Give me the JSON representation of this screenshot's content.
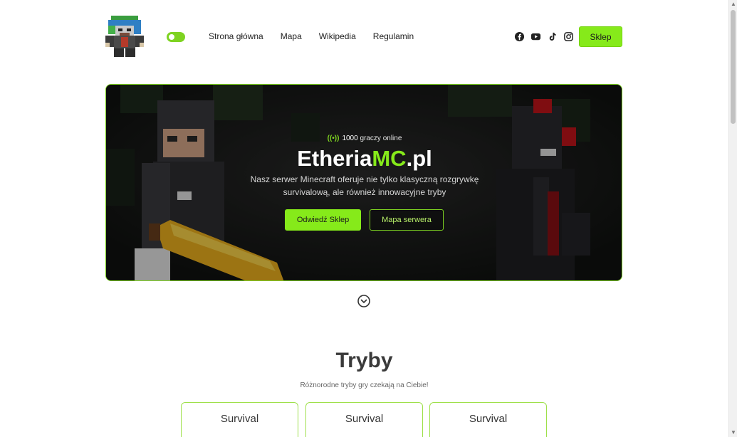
{
  "colors": {
    "accent": "#86ea1a",
    "accent_border": "#7ed321",
    "hero_bg": "#1b1b1b"
  },
  "header": {
    "logo_icon": "pixel-skin-logo-icon",
    "theme_toggle_icon": "toggle-switch-icon",
    "nav": [
      {
        "label": "Strona główna"
      },
      {
        "label": "Mapa"
      },
      {
        "label": "Wikipedia"
      },
      {
        "label": "Regulamin"
      }
    ],
    "socials": [
      "facebook-icon",
      "youtube-icon",
      "tiktok-icon",
      "instagram-icon"
    ],
    "shop_label": "Sklep"
  },
  "hero": {
    "online_icon": "broadcast-icon",
    "online_count": "1000",
    "online_text": "graczy online",
    "title_main": "Etheria",
    "title_accent": "MC",
    "title_suffix": ".pl",
    "description": "Nasz serwer Minecraft oferuje nie tylko klasyczną rozgrywkę survivalową, ale również innowacyjne tryby",
    "primary_button": "Odwiedź Sklep",
    "secondary_button": "Mapa serwera"
  },
  "scroll_icon": "chevron-down-circle-icon",
  "modes": {
    "title": "Tryby",
    "subtitle": "Różnorodne tryby gry czekają na Ciebie!",
    "cards": [
      {
        "name": "Survival"
      },
      {
        "name": "Survival"
      },
      {
        "name": "Survival"
      }
    ]
  }
}
